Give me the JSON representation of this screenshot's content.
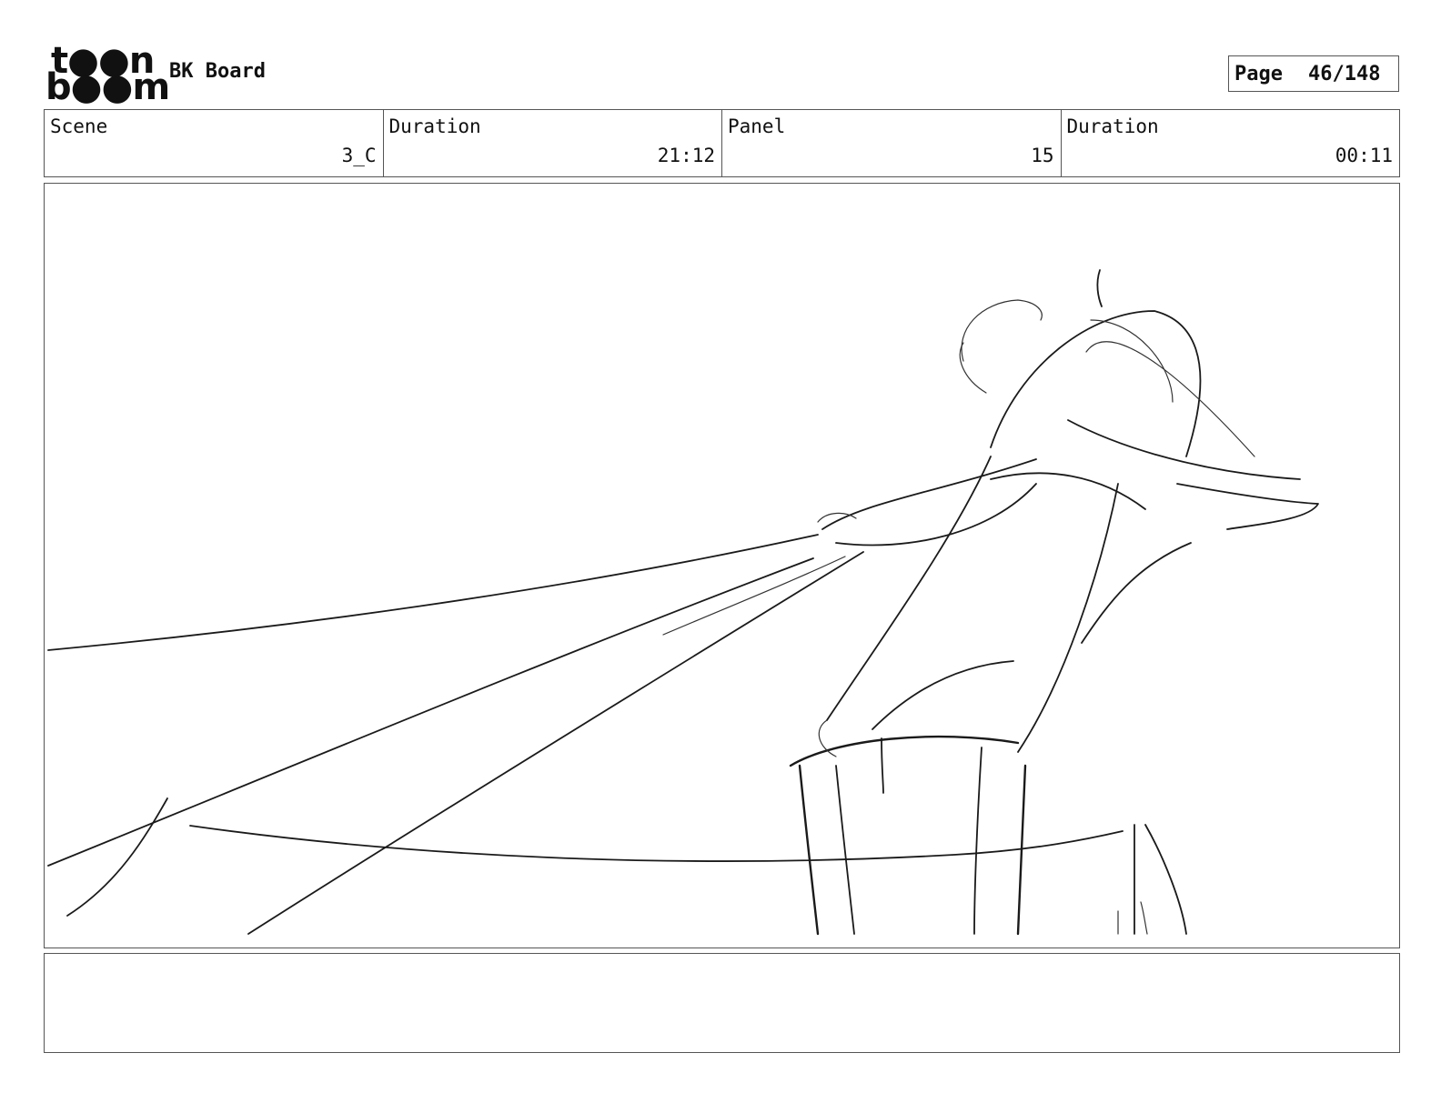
{
  "header": {
    "logo_line1": "t●●n",
    "logo_line2": "b●●m",
    "project_title": "BK Board",
    "page_label": "Page",
    "page_value": "46/148"
  },
  "info": {
    "scene_label": "Scene",
    "scene_value": "3_C",
    "scene_duration_label": "Duration",
    "scene_duration_value": "21:12",
    "panel_label": "Panel",
    "panel_value": "15",
    "panel_duration_label": "Duration",
    "panel_duration_value": "00:11"
  },
  "notes": {
    "text": ""
  }
}
